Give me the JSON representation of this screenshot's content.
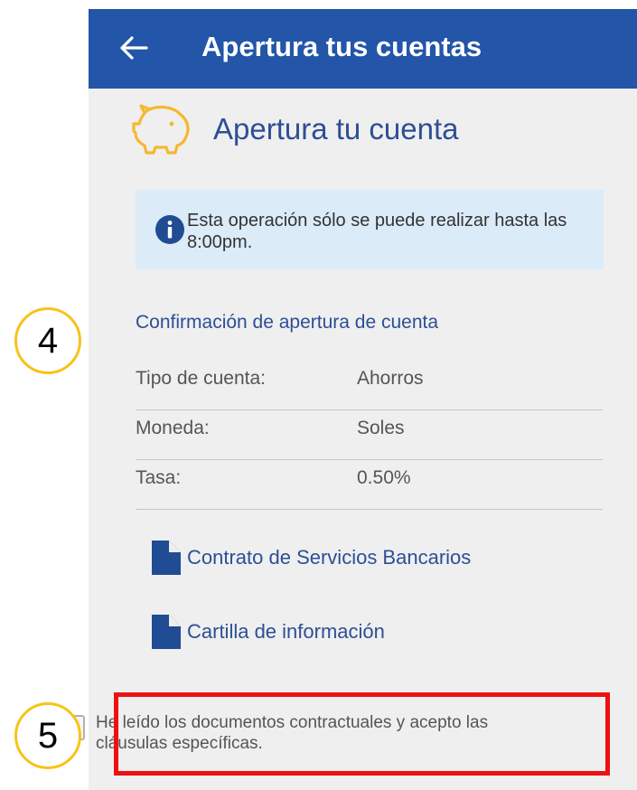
{
  "appbar": {
    "title": "Apertura tus cuentas",
    "back_icon": "arrow-left-icon"
  },
  "header": {
    "title": "Apertura tu cuenta",
    "icon": "piggy-bank-icon"
  },
  "info": {
    "icon": "info-icon",
    "text": "Esta operación sólo se puede realizar hasta las 8:00pm."
  },
  "confirmation": {
    "title": "Confirmación de apertura de cuenta",
    "rows": [
      {
        "label": "Tipo de cuenta:",
        "value": "Ahorros"
      },
      {
        "label": "Moneda:",
        "value": "Soles"
      },
      {
        "label": "Tasa:",
        "value": "0.50%"
      }
    ]
  },
  "documents": [
    {
      "label": "Contrato de Servicios Bancarios",
      "icon": "document-icon"
    },
    {
      "label": "Cartilla de información",
      "icon": "document-icon"
    }
  ],
  "consent": {
    "text": "He leído los documentos contractuales y acepto las cláusulas específicas.",
    "checked": false
  },
  "annotations": {
    "step4": "4",
    "step5": "5"
  },
  "colors": {
    "appbar": "#2355a8",
    "accent": "#2c4f95",
    "icon_gold": "#f5b82e",
    "info_bg": "#dcebf8",
    "highlight": "#ee1111",
    "step_ring": "#f7c31a"
  }
}
